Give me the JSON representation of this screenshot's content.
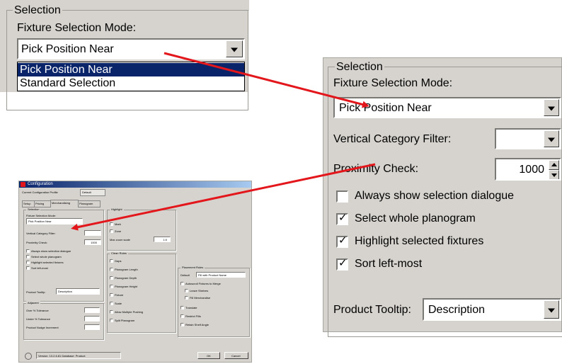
{
  "top_crop": {
    "group_title": "Selection",
    "mode_label": "Fixture Selection Mode:",
    "mode_value": "Pick Position Near",
    "options": [
      "Pick Position Near",
      "Standard Selection"
    ]
  },
  "zoomed": {
    "group_title": "Selection",
    "mode_label": "Fixture Selection Mode:",
    "mode_value": "Pick Position Near",
    "vertical_filter_label": "Vertical Category Filter:",
    "vertical_filter_value": "",
    "proximity_label": "Proximity Check:",
    "proximity_value": "1000",
    "checkboxes": [
      {
        "label": "Always show selection dialogue",
        "checked": false
      },
      {
        "label": "Select whole planogram",
        "checked": true
      },
      {
        "label": "Highlight selected fixtures",
        "checked": true
      },
      {
        "label": "Sort left-most",
        "checked": true
      }
    ],
    "tooltip_label": "Product Tooltip:",
    "tooltip_value": "Description"
  },
  "thumbnail": {
    "title": "Configuration",
    "tab_row1": [
      "Current Configuration Profile",
      "Default"
    ],
    "tab_row2": [
      "Setup",
      "Pricing",
      "Merchandising",
      "Planogram"
    ],
    "selection_title": "Selection",
    "mode_label": "Fixture Selection Mode:",
    "mode_value": "Pick Position Near",
    "vertical_label": "Vertical Category Filter:",
    "proximity_label": "Proximity Check:",
    "proximity_value": "1000",
    "checkboxes": [
      "Always show selection dialogue",
      "Select whole planogram",
      "Highlight selected fixtures",
      "Sort left-most"
    ],
    "tooltip_label": "Product Tooltip:",
    "tooltip_value": "Description",
    "adjacent_title": "Adjacent",
    "adjacent_rows": [
      "Over % Tolerance",
      "Under % Tolerance",
      "Product Nudge Increment"
    ],
    "highlight_title": "Highlight",
    "highlight_items": [
      "Mark",
      "Zone"
    ],
    "hide_label": "Max zoom scale",
    "hide_value": "1:0",
    "clear_title": "Clean Rules",
    "clear_items": [
      "Gaps",
      "Planogram Length",
      "Planogram Depth",
      "Planogram Height",
      "Fixture",
      "Scale",
      "Allow Multiple Pushing",
      "Split Planogram"
    ],
    "placement_title": "Placement Rules",
    "placement_default_label": "Default",
    "placement_default_value": "Fill with Product Name",
    "placement_items": [
      "Autoscroll Fixtures to Merge",
      "Leave Shelves",
      "Fill Merchandise",
      "Translate",
      "Restrict Fills",
      "Retain Shelf Angle"
    ],
    "status_text": "Version: 13.2.6.81 Database: Product",
    "ok_label": "OK",
    "cancel_label": "Cancel"
  },
  "colors": {
    "dialog_bg": "#d6d3ce",
    "highlight": "#0a246a",
    "arrow": "#e3161b",
    "title_bar": "#0a246a"
  }
}
